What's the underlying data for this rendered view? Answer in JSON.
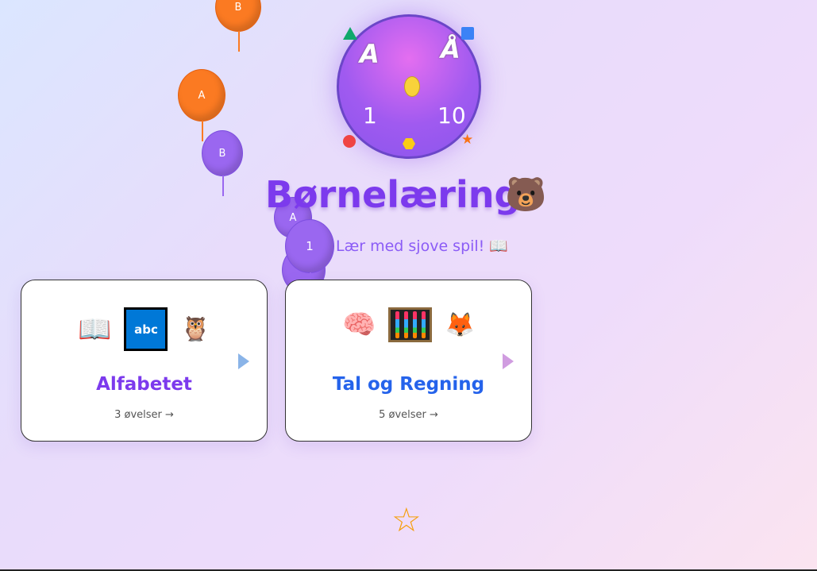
{
  "logo": {
    "letters": [
      "A",
      "Å"
    ],
    "numbers": [
      "1",
      "10"
    ]
  },
  "header": {
    "title": "Børnelæring",
    "title_emoji": "🐻",
    "subtitle": "Lær med sjove spil! 📖"
  },
  "balloons": [
    "B",
    "A",
    "B",
    "A",
    "1"
  ],
  "cards": [
    {
      "title": "Alfabetet",
      "count": "3 øvelser →",
      "icons": [
        "📖",
        "abc",
        "🦉"
      ],
      "color": "#7c3aed",
      "arrow_color": "#8ab4e8"
    },
    {
      "title": "Tal og Regning",
      "count": "5 øvelser →",
      "icons": [
        "🧠",
        "abacus",
        "🦊"
      ],
      "color": "#2563eb",
      "arrow_color": "#d09ce0"
    }
  ],
  "footer": {
    "star": "☆"
  }
}
